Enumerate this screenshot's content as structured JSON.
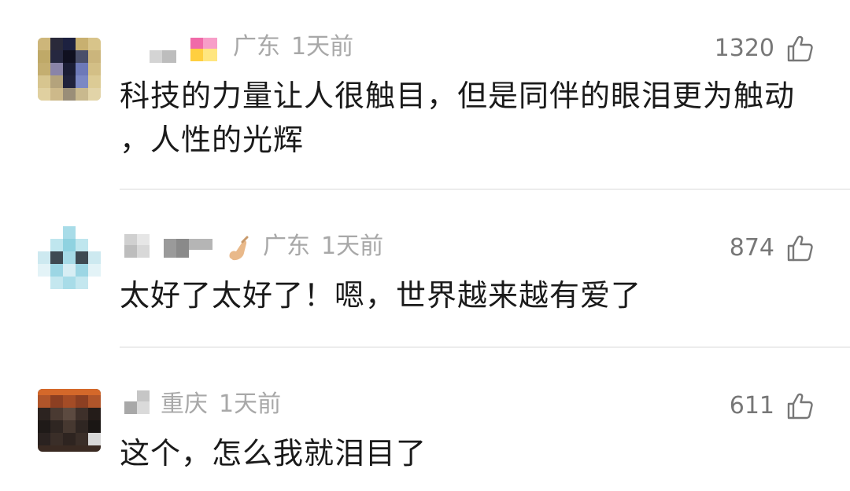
{
  "comments": [
    {
      "location": "广东",
      "time": "1天前",
      "likes": "1320",
      "text": "科技的力量让人很触目，但是同伴的眼泪更为触动 ，人性的光辉"
    },
    {
      "location": "广东",
      "time": "1天前",
      "likes": "874",
      "text": "太好了太好了！嗯，世界越来越有爱了"
    },
    {
      "location": "重庆",
      "time": "1天前",
      "likes": "611",
      "text": "这个，怎么我就泪目了"
    }
  ],
  "icons": {
    "like": "thumbs-up-icon",
    "badge_1": "colorful-badge-icon",
    "badge_2": "hand-badge-icon"
  },
  "colors": {
    "meta_text": "#a8a8a8",
    "like_count": "#777777",
    "body_text": "#1a1a1a",
    "divider": "#ececec"
  }
}
